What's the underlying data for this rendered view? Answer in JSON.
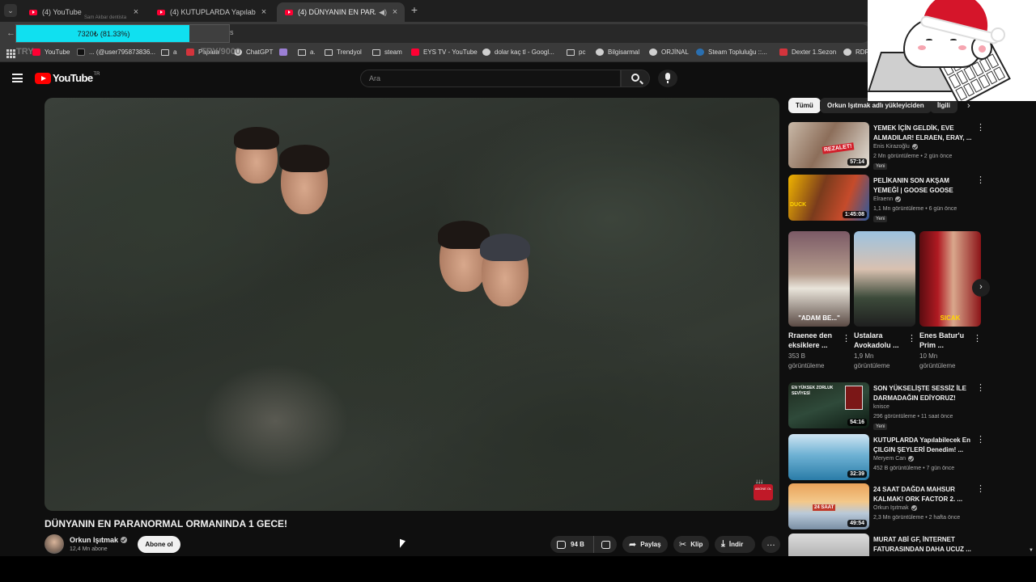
{
  "browser": {
    "tabs": [
      {
        "title": "(4) YouTube",
        "active": false
      },
      {
        "title": "(4) KUTUPLARDA Yapılabilecek",
        "active": false
      },
      {
        "title": "(4) DÜNYANIN EN PARANORMAL",
        "active": true
      }
    ],
    "progress": {
      "text": "7320₺ (81.33%)",
      "fraction": 0.8133
    },
    "omnibox_tail": "s",
    "ghost_top": "Sam Akbar dentista",
    "ghost_left": "TRY",
    "ghost_mid": "TRY/9000",
    "bookmarks": [
      {
        "label": "YouTube",
        "icon": "youtube-icon"
      },
      {
        "label": "... (@user795873836...",
        "icon": "tiktok-icon"
      },
      {
        "label": "a",
        "icon": "folder-icon"
      },
      {
        "label": "Papara",
        "icon": "papara-icon"
      },
      {
        "label": "ChatGPT",
        "icon": "chatgpt-icon"
      },
      {
        "label": "",
        "icon": "feather-icon"
      },
      {
        "label": "a.",
        "icon": "folder-icon"
      },
      {
        "label": "Trendyol",
        "icon": "folder-icon"
      },
      {
        "label": "steam",
        "icon": "folder-icon"
      },
      {
        "label": "EYS TV - YouTube",
        "icon": "youtube-icon"
      },
      {
        "label": "dolar kaç tl - Googl...",
        "icon": "google-icon"
      },
      {
        "label": "pc",
        "icon": "folder-icon"
      },
      {
        "label": "Bilgisarmal",
        "icon": "globe-icon"
      },
      {
        "label": "ORJİNAL",
        "icon": "globe-icon"
      },
      {
        "label": "Steam Topluluğu ::...",
        "icon": "steam-icon"
      },
      {
        "label": "Dexter 1.Sezon",
        "icon": "red-icon"
      },
      {
        "label": "RDR",
        "icon": "globe-icon"
      }
    ]
  },
  "youtube": {
    "logo_text": "YouTube",
    "logo_region": "TR",
    "search_placeholder": "Ara"
  },
  "video": {
    "title": "DÜNYANIN EN PARANORMAL ORMANINDA 1 GECE!",
    "channel": "Orkun Işıtmak",
    "subscribers": "12,4 Mn abone",
    "subscribe_label": "Abone ol",
    "likes": "94 B",
    "share_label": "Paylaş",
    "clip_label": "Klip",
    "download_label": "İndir",
    "overlay_badge": "ABONE OL"
  },
  "sidebar": {
    "chips": [
      "Tümü",
      "Orkun Işıtmak adlı yükleyiciden",
      "İlgili"
    ],
    "videos_top": [
      {
        "title": "YEMEK İÇİN GELDİK, EVE ALMADILAR! ELRAEN, ERAY, ...",
        "channel": "Enis Kirazoğlu",
        "meta": "2 Mn görüntüleme • 2 gün önce",
        "badge": "Yeni",
        "duration": "57:14",
        "thumb_caption": "REZALET!"
      },
      {
        "title": "PELİKANIN SON AKŞAM YEMEĞİ | GOOSE GOOSE DUC...",
        "channel": "Elraenn",
        "meta": "1,1 Mn görüntüleme • 6 gün önce",
        "badge": "Yeni",
        "duration": "1:45:08",
        "thumb_caption": "DUCK"
      }
    ],
    "shorts": [
      {
        "title": "Rraenee den eksiklere ...",
        "views": "353 B görüntüleme",
        "caption": "\"ADAM BE...\""
      },
      {
        "title": "Ustalara Avokadolu ...",
        "views": "1,9 Mn görüntüleme",
        "caption": ""
      },
      {
        "title": "Enes Batur'u Prim ...",
        "views": "10 Mn görüntüleme",
        "caption": "SICAK"
      }
    ],
    "videos_bottom": [
      {
        "title": "SON YÜKSELİŞTE SESSİZ İLE DARMADAĞIN EDİYORUZ! (Sla...",
        "channel": "kniscе",
        "meta": "296 görüntüleme • 11 saat önce",
        "badge": "Yeni",
        "duration": "54:16",
        "thumb_caption": "EN YÜKSEK ZORLUK SEVİYESİ"
      },
      {
        "title": "KUTUPLARDA Yapılabilecek En ÇILGIN ŞEYLERİ Denedim! ...",
        "channel": "Meryem Can",
        "meta": "452 B görüntüleme • 7 gün önce",
        "badge": "",
        "duration": "32:39",
        "thumb_caption": ""
      },
      {
        "title": "24 SAAT DAĞDA MAHSUR KALMAK! ORK FACTOR 2. ...",
        "channel": "Orkun Işıtmak",
        "meta": "2,3 Mn görüntüleme • 2 hafta önce",
        "badge": "",
        "duration": "49:54",
        "thumb_caption": "24 SAAT"
      },
      {
        "title": "MURAT ABİ GF, İNTERNET FATURASINDAN DAHA UCUZ ...",
        "channel": "",
        "meta": "",
        "badge": "",
        "duration": "",
        "thumb_caption": ""
      }
    ]
  },
  "colors": {
    "accent_red": "#ff0000",
    "progress_cyan": "#10e0f0",
    "background": "#0f0f0f"
  }
}
